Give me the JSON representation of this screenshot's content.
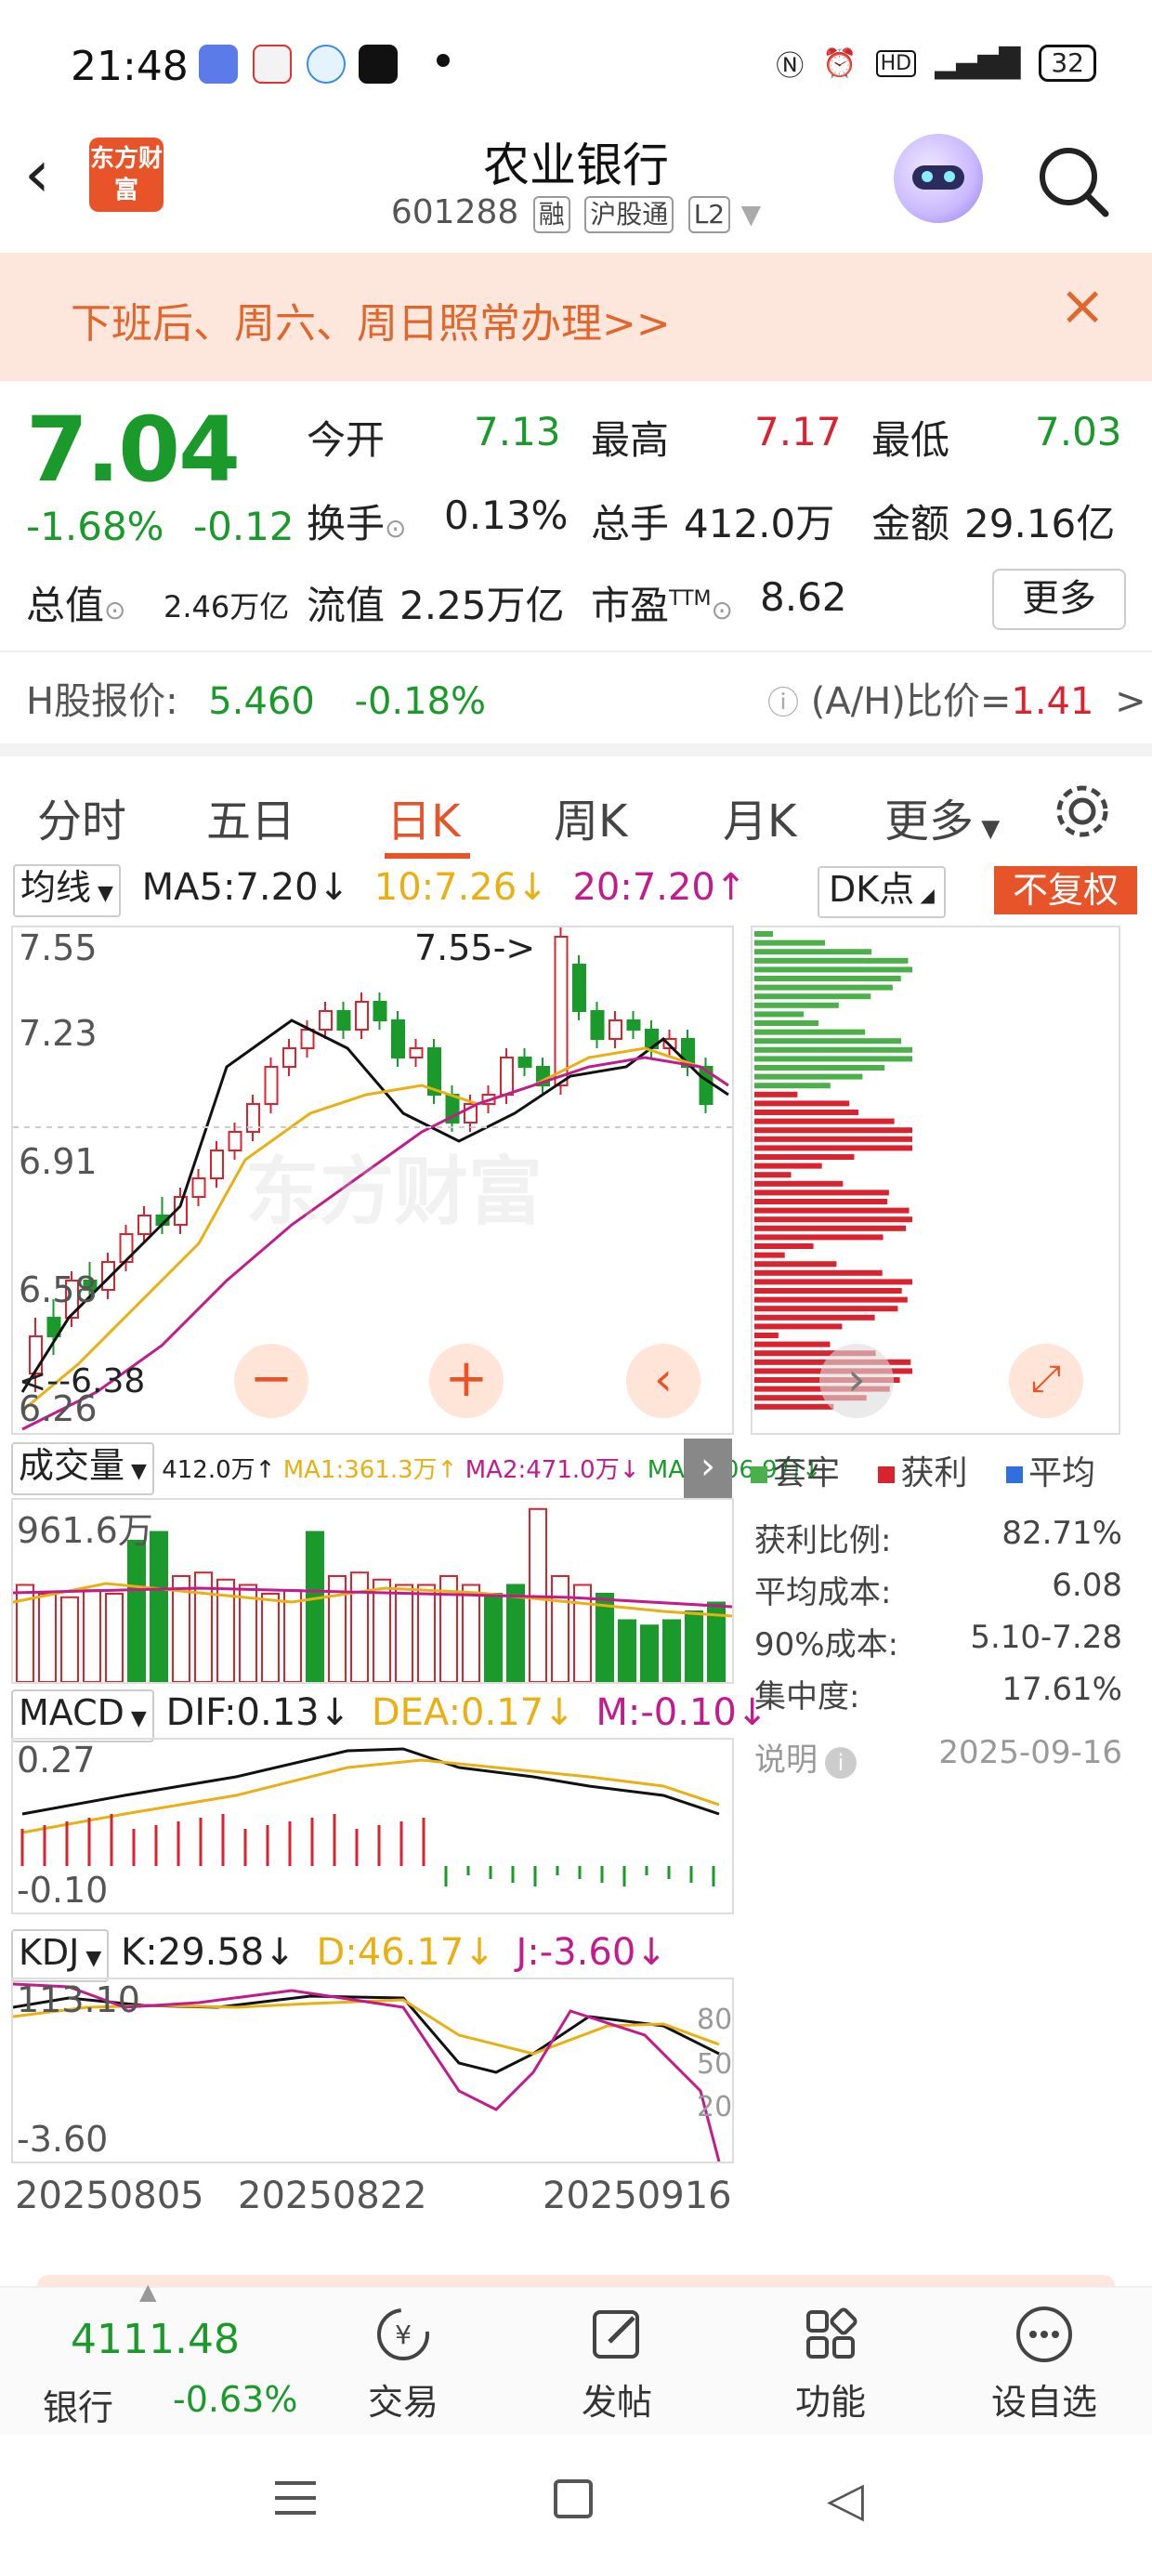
{
  "status_bar": {
    "time": "21:48",
    "battery": "32"
  },
  "header": {
    "stock_name": "农业银行",
    "stock_code": "601288",
    "tags": [
      "融",
      "沪股通",
      "L2"
    ],
    "logo_text": "东方财富"
  },
  "banner": {
    "text": "下班后、周六、周日照常办理>>"
  },
  "quote": {
    "price": "7.04",
    "change_pct": "-1.68%",
    "change_abs": "-0.12",
    "open_label": "今开",
    "open": "7.13",
    "high_label": "最高",
    "high": "7.17",
    "low_label": "最低",
    "low": "7.03",
    "turnover_label": "换手",
    "turnover": "0.13%",
    "volume_label": "总手",
    "volume": "412.0万",
    "amount_label": "金额",
    "amount": "29.16亿",
    "mktcap_label": "总值",
    "mktcap": "2.46万亿",
    "float_label": "流值",
    "float": "2.25万亿",
    "pe_label": "市盈",
    "pe_sup": "TTM",
    "pe": "8.62",
    "more": "更多"
  },
  "h_share": {
    "label": "H股报价:",
    "price": "5.460",
    "change": "-0.18%",
    "ah_label": "(A/H)比价=",
    "ah_value": "1.41",
    "arrow": ">"
  },
  "tabs": [
    "分时",
    "五日",
    "日K",
    "周K",
    "月K",
    "更多"
  ],
  "ma_row": {
    "selector": "均线",
    "ma5": "MA5:7.20",
    "ma10": "10:7.26",
    "ma20": "20:7.20",
    "dk": "DK点",
    "fuquan": "不复权"
  },
  "kline_axis": [
    "7.55",
    "7.23",
    "6.91",
    "6.58",
    "6.26"
  ],
  "kline_annotations": {
    "high_mark": "7.55->",
    "low_mark": "<--6.38",
    "watermark": "东方财富"
  },
  "volume_row": {
    "selector": "成交量",
    "vol": "412.0万",
    "ma1": "MA1:361.3万",
    "ma2": "MA2:471.0万",
    "ma3": "MA3:506.9万",
    "max": "961.6万"
  },
  "macd_row": {
    "selector": "MACD",
    "dif": "DIF:0.13",
    "dea": "DEA:0.17",
    "m": "M:-0.10",
    "top": "0.27",
    "bottom": "-0.10"
  },
  "kdj_row": {
    "selector": "KDJ",
    "k": "K:29.58",
    "d": "D:46.17",
    "j": "J:-3.60",
    "top": "113.10",
    "bottom": "-3.60",
    "levels": [
      "80",
      "50",
      "20"
    ]
  },
  "dates": [
    "20250805",
    "20250822",
    "20250916"
  ],
  "chip": {
    "legend": [
      "套牢",
      "获利",
      "平均"
    ],
    "stats": [
      {
        "label": "获利比例:",
        "value": "82.71%"
      },
      {
        "label": "平均成本:",
        "value": "6.08"
      },
      {
        "label": "90%成本:",
        "value": "5.10-7.28"
      },
      {
        "label": "集中度:",
        "value": "17.61%"
      }
    ],
    "note_label": "说明",
    "note_date": "2025-09-16"
  },
  "bottom_bar": {
    "index_value": "4111.48",
    "index_name": "银行",
    "index_change": "-0.63%",
    "items": [
      "交易",
      "发帖",
      "功能",
      "设自选"
    ]
  },
  "colors": {
    "up": "#d9232f",
    "down": "#1a9a2a",
    "accent": "#e8542a",
    "ma5": "#111111",
    "ma10": "#e8b012",
    "ma20": "#c21b8c"
  }
}
